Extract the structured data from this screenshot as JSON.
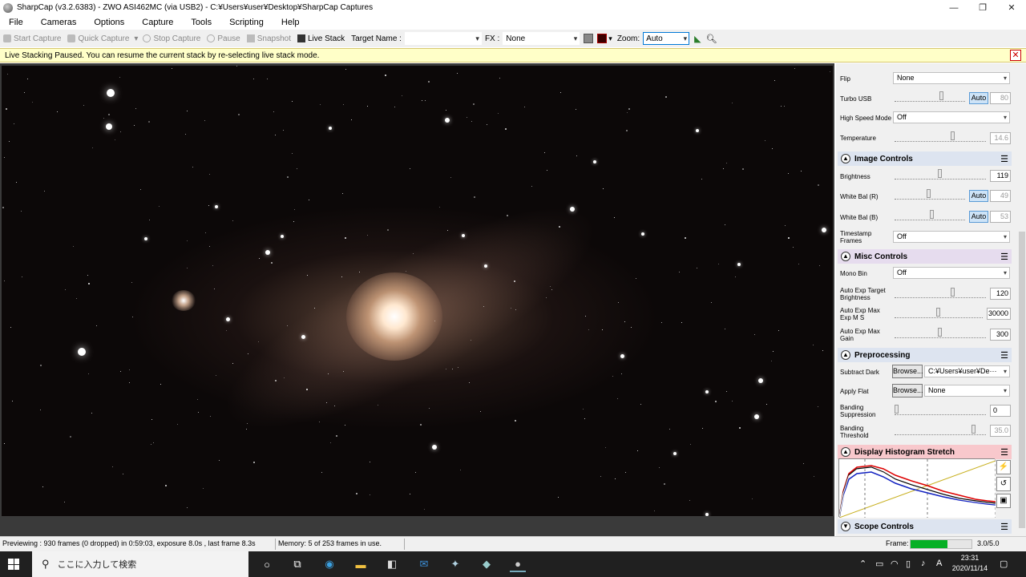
{
  "window": {
    "title": "SharpCap (v3.2.6383) - ZWO ASI462MC (via USB2) - C:¥Users¥user¥Desktop¥SharpCap Captures",
    "minimize": "—",
    "maximize": "❐",
    "close": "✕"
  },
  "menu": [
    "File",
    "Cameras",
    "Options",
    "Capture",
    "Tools",
    "Scripting",
    "Help"
  ],
  "toolbar": {
    "start_capture": "Start Capture",
    "quick_capture": "Quick Capture",
    "stop_capture": "Stop Capture",
    "pause": "Pause",
    "snapshot": "Snapshot",
    "live_stack": "Live Stack",
    "target_name_label": "Target Name :",
    "target_name_value": "",
    "fx_label": "FX :",
    "fx_value": "None",
    "zoom_label": "Zoom:",
    "zoom_value": "Auto"
  },
  "notification": {
    "message": "Live Stacking Paused. You can resume the current stack by re-selecting live stack mode."
  },
  "panel": {
    "flip": {
      "label": "Flip",
      "value": "None"
    },
    "turbo_usb": {
      "label": "Turbo USB",
      "auto": "Auto",
      "value": "80"
    },
    "high_speed": {
      "label": "High Speed Mode",
      "value": "Off"
    },
    "temperature": {
      "label": "Temperature",
      "value": "14.6"
    },
    "image_controls": {
      "title": "Image Controls",
      "brightness": {
        "label": "Brightness",
        "value": "119"
      },
      "wb_r": {
        "label": "White Bal (R)",
        "auto": "Auto",
        "value": "49"
      },
      "wb_b": {
        "label": "White Bal (B)",
        "auto": "Auto",
        "value": "53"
      },
      "timestamp": {
        "label": "Timestamp Frames",
        "value": "Off"
      }
    },
    "misc_controls": {
      "title": "Misc Controls",
      "mono_bin": {
        "label": "Mono Bin",
        "value": "Off"
      },
      "auto_exp_target": {
        "label": "Auto Exp Target Brightness",
        "value": "120"
      },
      "auto_exp_max_ms": {
        "label": "Auto Exp Max Exp M S",
        "value": "30000"
      },
      "auto_exp_max_gain": {
        "label": "Auto Exp Max Gain",
        "value": "300"
      }
    },
    "preprocessing": {
      "title": "Preprocessing",
      "subtract_dark": {
        "label": "Subtract Dark",
        "browse": "Browse...",
        "value": "C:¥Users¥user¥De···"
      },
      "apply_flat": {
        "label": "Apply Flat",
        "browse": "Browse...",
        "value": "None"
      },
      "banding_suppression": {
        "label": "Banding Suppression",
        "value": "0"
      },
      "banding_threshold": {
        "label": "Banding Threshold",
        "value": "35.0"
      }
    },
    "histogram": {
      "title": "Display Histogram Stretch"
    },
    "scope_controls": {
      "title": "Scope Controls"
    }
  },
  "status": {
    "preview": "Previewing : 930 frames (0 dropped) in 0:59:03, exposure 8.0s , last frame 8.3s",
    "memory": "Memory: 5 of 253 frames in use.",
    "frame_label": "Frame:",
    "frame_value": "3.0/5.0",
    "frame_progress": 0.6,
    "accent": "#06b025"
  },
  "taskbar": {
    "search_placeholder": "ここに入力して検索",
    "time": "23:31",
    "date": "2020/11/14",
    "ime": "A"
  }
}
